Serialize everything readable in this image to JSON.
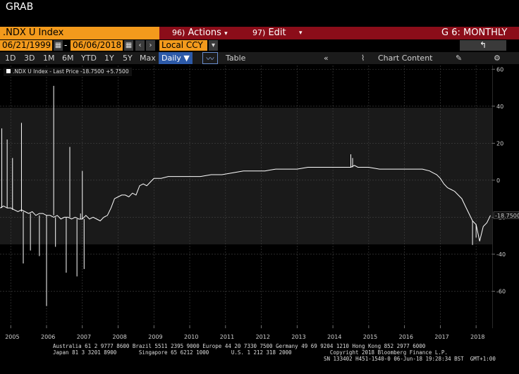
{
  "window": {
    "title": "GRAB"
  },
  "header": {
    "ticker": ".NDX U Index",
    "actions_num": "96)",
    "actions_label": "Actions",
    "edit_num": "97)",
    "edit_label": "Edit",
    "page_label": "G 6: MONTHLY"
  },
  "range": {
    "start_date": "06/21/1999",
    "separator": "-",
    "end_date": "06/06/2018",
    "currency": "Local CCY"
  },
  "toolbar": {
    "periods": [
      "1D",
      "3D",
      "1M",
      "6M",
      "YTD",
      "1Y",
      "5Y",
      "Max"
    ],
    "frequency": "Daily",
    "table_label": "Table",
    "chart_content_label": "Chart Content"
  },
  "legend": {
    "text": ".NDX U Index - Last Price -18.7500 +5.7500"
  },
  "chart_data": {
    "type": "line",
    "title": "",
    "xlabel": "",
    "ylabel": "",
    "x_ticks": [
      "2005",
      "2006",
      "2007",
      "2008",
      "2009",
      "2010",
      "2011",
      "2012",
      "2013",
      "2014",
      "2015",
      "2016",
      "2017",
      "2018"
    ],
    "y_ticks": [
      60,
      40,
      20,
      0,
      -20,
      -40,
      -60
    ],
    "ylim": [
      -80,
      62
    ],
    "xlim": [
      2004.7,
      2018.45
    ],
    "last_value_label": "-18.7500",
    "grid": true,
    "series": [
      {
        "color": "#ffffff",
        "x": [
          2004.7,
          2004.8,
          2004.9,
          2005.0,
          2005.1,
          2005.2,
          2005.3,
          2005.4,
          2005.5,
          2005.6,
          2005.7,
          2005.8,
          2005.9,
          2006.0,
          2006.1,
          2006.2,
          2006.3,
          2006.4,
          2006.5,
          2006.6,
          2006.7,
          2006.8,
          2006.9,
          2007.0,
          2007.1,
          2007.2,
          2007.3,
          2007.4,
          2007.5,
          2007.6,
          2007.7,
          2007.8,
          2007.9,
          2008.0,
          2008.1,
          2008.2,
          2008.3,
          2008.4,
          2008.5,
          2008.6,
          2008.7,
          2008.8,
          2008.9,
          2009.0,
          2009.2,
          2009.4,
          2009.6,
          2009.8,
          2010.0,
          2010.3,
          2010.6,
          2010.9,
          2011.2,
          2011.5,
          2011.8,
          2012.1,
          2012.4,
          2012.7,
          2013.0,
          2013.3,
          2013.6,
          2013.9,
          2014.2,
          2014.5,
          2014.6,
          2014.7,
          2014.8,
          2015.0,
          2015.3,
          2015.6,
          2015.9,
          2016.2,
          2016.5,
          2016.7,
          2016.8,
          2016.9,
          2017.0,
          2017.1,
          2017.2,
          2017.3,
          2017.4,
          2017.5,
          2017.6,
          2017.7,
          2017.8,
          2017.9,
          2018.0,
          2018.1,
          2018.2,
          2018.3,
          2018.4
        ],
        "y": [
          -15,
          -14,
          -15,
          -15,
          -16,
          -17,
          -16,
          -17,
          -18,
          -17,
          -19,
          -18,
          -18,
          -19,
          -19,
          -20,
          -19,
          -21,
          -20,
          -20,
          -21,
          -20,
          -21,
          -21,
          -19,
          -21,
          -20,
          -21,
          -22,
          -20,
          -19,
          -15,
          -10,
          -9,
          -8,
          -8,
          -9,
          -7,
          -8,
          -3,
          -2,
          -3,
          -1,
          1,
          1,
          2,
          2,
          2,
          2,
          2,
          3,
          3,
          4,
          5,
          5,
          5,
          6,
          6,
          6,
          7,
          7,
          7,
          7,
          7,
          8,
          7,
          7,
          7,
          6,
          6,
          6,
          6,
          6,
          5,
          4,
          3,
          1,
          -2,
          -4,
          -5,
          -6,
          -8,
          -10,
          -14,
          -18,
          -22,
          -24,
          -33,
          -25,
          -23,
          -19
        ]
      }
    ]
  },
  "footer": {
    "line1": "Australia 61 2 9777 8600 Brazil 5511 2395 9000 Europe 44 20 7330 7500 Germany 49 69 9204 1210 Hong Kong 852 2977 6000",
    "line2": "Japan 81 3 3201 8900       Singapore 65 6212 1000       U.S. 1 212 318 2000            Copyright 2018 Bloomberg Finance L.P.",
    "line3": "SN 133402 H451-1540-0 06-Jun-18 19:28:34 BST  GMT+1:00"
  },
  "colors": {
    "orange": "#f39a1c",
    "red": "#8b0d19",
    "plot_bg": "#1a1a1a",
    "band_bg": "#0d0d0d",
    "line": "#ffffff"
  }
}
